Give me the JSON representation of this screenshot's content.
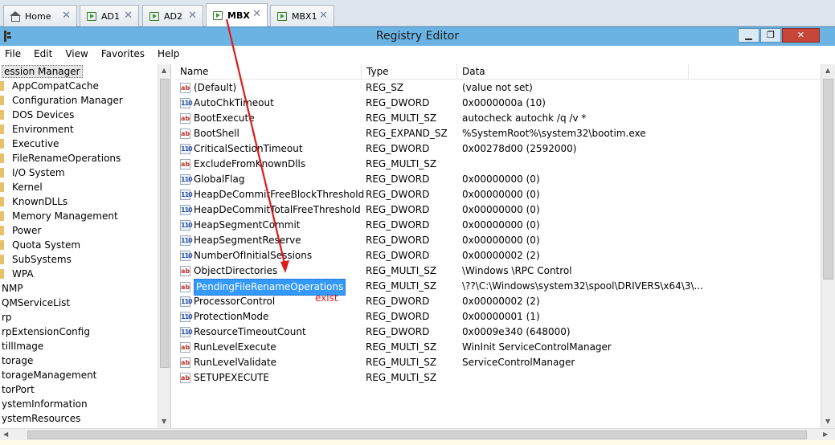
{
  "tabs": [
    {
      "label": "Home",
      "icon": "home-icon"
    },
    {
      "label": "AD1",
      "icon": "remote-desktop-icon"
    },
    {
      "label": "AD2",
      "icon": "remote-desktop-icon"
    },
    {
      "label": "MBX",
      "icon": "remote-desktop-icon",
      "active": true
    },
    {
      "label": "MBX1",
      "icon": "remote-desktop-icon"
    }
  ],
  "window": {
    "title": "Registry Editor",
    "controls": {
      "minimize": "▁",
      "maximize": "❐",
      "close": "✕"
    }
  },
  "menu": [
    "File",
    "Edit",
    "View",
    "Favorites",
    "Help"
  ],
  "tree": {
    "items": [
      {
        "label": "ession Manager",
        "selected": true,
        "folder": false
      },
      {
        "label": "AppCompatCache",
        "folder": true
      },
      {
        "label": "Configuration Manager",
        "folder": true
      },
      {
        "label": "DOS Devices",
        "folder": true
      },
      {
        "label": "Environment",
        "folder": true
      },
      {
        "label": "Executive",
        "folder": true
      },
      {
        "label": "FileRenameOperations",
        "folder": true
      },
      {
        "label": "I/O System",
        "folder": true
      },
      {
        "label": "Kernel",
        "folder": true
      },
      {
        "label": "KnownDLLs",
        "folder": true
      },
      {
        "label": "Memory Management",
        "folder": true
      },
      {
        "label": "Power",
        "folder": true
      },
      {
        "label": "Quota System",
        "folder": true
      },
      {
        "label": "SubSystems",
        "folder": true
      },
      {
        "label": "WPA",
        "folder": true
      },
      {
        "label": "NMP",
        "folder": false
      },
      {
        "label": "QMServiceList",
        "folder": false
      },
      {
        "label": "rp",
        "folder": false
      },
      {
        "label": "rpExtensionConfig",
        "folder": false
      },
      {
        "label": "tillImage",
        "folder": false
      },
      {
        "label": "torage",
        "folder": false
      },
      {
        "label": "torageManagement",
        "folder": false
      },
      {
        "label": "torPort",
        "folder": false
      },
      {
        "label": "ystemInformation",
        "folder": false
      },
      {
        "label": "ystemResources",
        "folder": false
      }
    ]
  },
  "list": {
    "columns": [
      "Name",
      "Type",
      "Data"
    ],
    "rows": [
      {
        "name": "(Default)",
        "type": "REG_SZ",
        "data": "(value not set)",
        "icon": "sz"
      },
      {
        "name": "AutoChkTimeout",
        "type": "REG_DWORD",
        "data": "0x0000000a (10)",
        "icon": "bin"
      },
      {
        "name": "BootExecute",
        "type": "REG_MULTI_SZ",
        "data": "autocheck autochk /q /v *",
        "icon": "sz"
      },
      {
        "name": "BootShell",
        "type": "REG_EXPAND_SZ",
        "data": "%SystemRoot%\\system32\\bootim.exe",
        "icon": "sz"
      },
      {
        "name": "CriticalSectionTimeout",
        "type": "REG_DWORD",
        "data": "0x00278d00 (2592000)",
        "icon": "bin"
      },
      {
        "name": "ExcludeFromKnownDlls",
        "type": "REG_MULTI_SZ",
        "data": "",
        "icon": "sz"
      },
      {
        "name": "GlobalFlag",
        "type": "REG_DWORD",
        "data": "0x00000000 (0)",
        "icon": "bin"
      },
      {
        "name": "HeapDeCommitFreeBlockThreshold",
        "type": "REG_DWORD",
        "data": "0x00000000 (0)",
        "icon": "bin"
      },
      {
        "name": "HeapDeCommitTotalFreeThreshold",
        "type": "REG_DWORD",
        "data": "0x00000000 (0)",
        "icon": "bin"
      },
      {
        "name": "HeapSegmentCommit",
        "type": "REG_DWORD",
        "data": "0x00000000 (0)",
        "icon": "bin"
      },
      {
        "name": "HeapSegmentReserve",
        "type": "REG_DWORD",
        "data": "0x00000000 (0)",
        "icon": "bin"
      },
      {
        "name": "NumberOfInitialSessions",
        "type": "REG_DWORD",
        "data": "0x00000002 (2)",
        "icon": "bin"
      },
      {
        "name": "ObjectDirectories",
        "type": "REG_MULTI_SZ",
        "data": "\\Windows \\RPC Control",
        "icon": "sz"
      },
      {
        "name": "PendingFileRenameOperations",
        "type": "REG_MULTI_SZ",
        "data": "\\??\\C:\\Windows\\system32\\spool\\DRIVERS\\x64\\3\\...",
        "icon": "sz",
        "selected": true
      },
      {
        "name": "ProcessorControl",
        "type": "REG_DWORD",
        "data": "0x00000002 (2)",
        "icon": "bin"
      },
      {
        "name": "ProtectionMode",
        "type": "REG_DWORD",
        "data": "0x00000001 (1)",
        "icon": "bin"
      },
      {
        "name": "ResourceTimeoutCount",
        "type": "REG_DWORD",
        "data": "0x0009e340 (648000)",
        "icon": "bin"
      },
      {
        "name": "RunLevelExecute",
        "type": "REG_MULTI_SZ",
        "data": "WinInit ServiceControlManager",
        "icon": "sz"
      },
      {
        "name": "RunLevelValidate",
        "type": "REG_MULTI_SZ",
        "data": "ServiceControlManager",
        "icon": "sz"
      },
      {
        "name": "SETUPEXECUTE",
        "type": "REG_MULTI_SZ",
        "data": "",
        "icon": "sz"
      }
    ]
  },
  "annotation": {
    "text": "exist",
    "color": "#d81e1e"
  },
  "icons": {
    "sz": "ab",
    "bin": "110",
    "tab_close": "✕",
    "arrow_up": "▲",
    "arrow_down": "▼",
    "arrow_left": "◀",
    "arrow_right": "▶"
  }
}
